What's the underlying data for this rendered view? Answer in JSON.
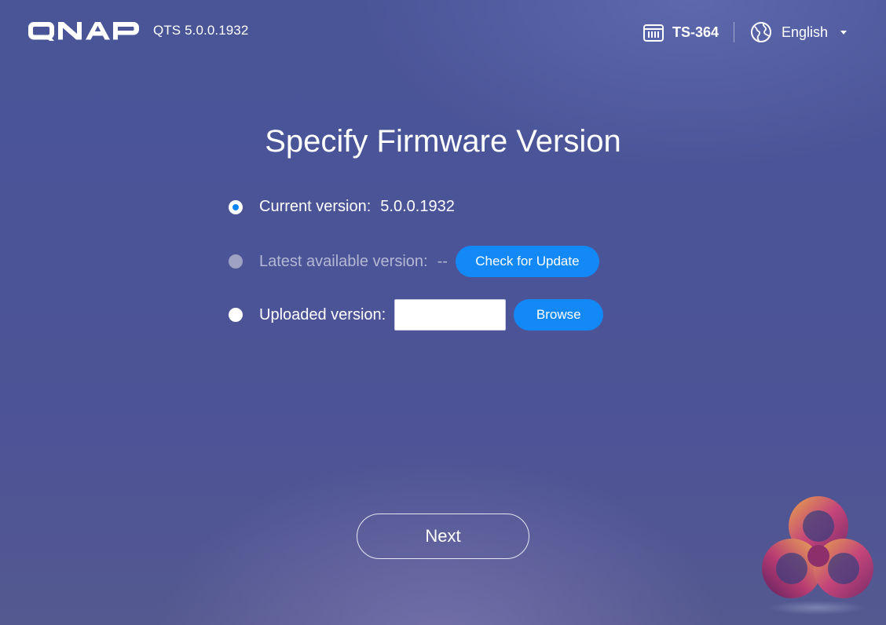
{
  "header": {
    "brand_logo_text": "QNAP",
    "firmware_label": "QTS 5.0.0.1932",
    "device_icon": "nas-device-icon",
    "device_name": "TS-364",
    "language_icon": "globe-icon",
    "language": "English"
  },
  "main": {
    "title": "Specify Firmware Version",
    "options": {
      "current": {
        "label": "Current version:",
        "value": "5.0.0.1932",
        "selected": true
      },
      "latest": {
        "label": "Latest available version:",
        "value": "--",
        "enabled": false,
        "button_label": "Check for Update"
      },
      "uploaded": {
        "label": "Uploaded version:",
        "input_value": "",
        "button_label": "Browse"
      }
    },
    "next_label": "Next"
  },
  "colors": {
    "accent": "#1389f8",
    "background": "#4a5598"
  },
  "watermark_icon": "logo-watermark-icon"
}
